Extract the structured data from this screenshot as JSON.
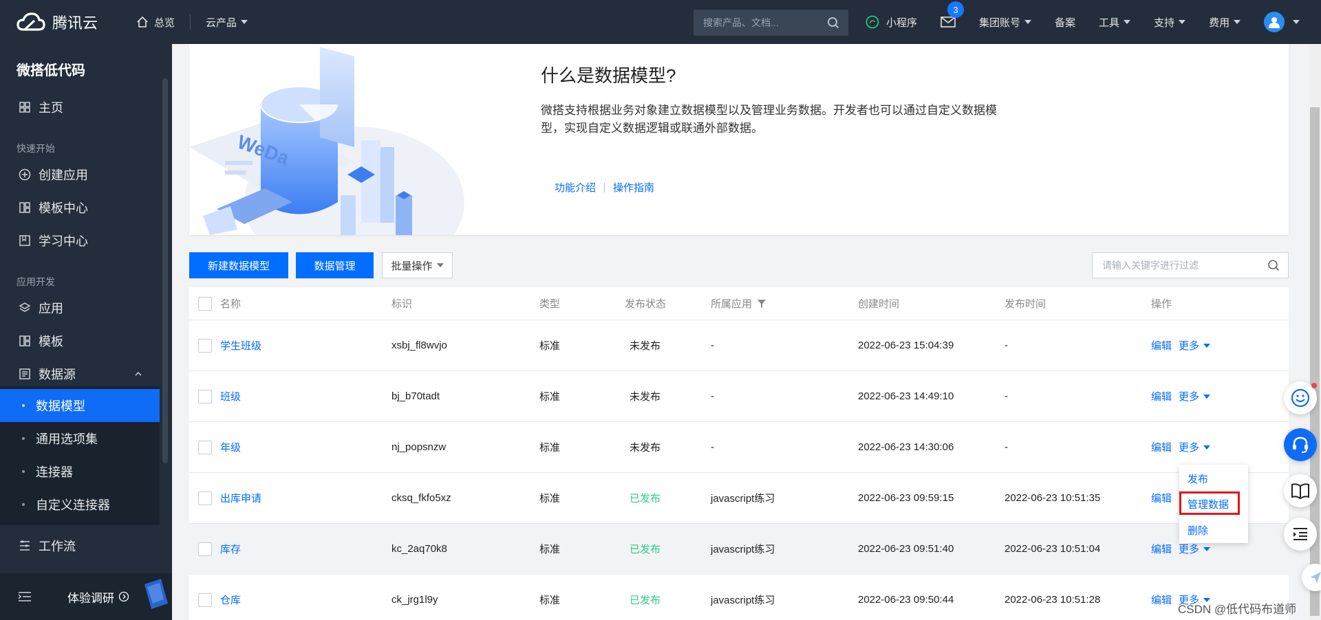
{
  "topbar": {
    "brand": "腾讯云",
    "home": "总览",
    "products": "云产品",
    "search_placeholder": "搜索产品、文档...",
    "mini_program": "小程序",
    "mail_badge": "3",
    "group_account": "集团账号",
    "filing": "备案",
    "tools": "工具",
    "support": "支持",
    "fees": "费用"
  },
  "sidebar": {
    "title": "微搭低代码",
    "home": "主页",
    "group_quick": "快速开始",
    "create_app": "创建应用",
    "template_center": "模板中心",
    "learning_center": "学习中心",
    "group_dev": "应用开发",
    "apps": "应用",
    "templates": "模板",
    "datasource": "数据源",
    "sub": [
      "数据模型",
      "通用选项集",
      "连接器",
      "自定义连接器"
    ],
    "workflow": "工作流",
    "survey": "体验调研"
  },
  "intro": {
    "title": "什么是数据模型?",
    "desc": "微搭支持根据业务对象建立数据模型以及管理业务数据。开发者也可以通过自定义数据模型，实现自定义数据逻辑或联通外部数据。",
    "link1": "功能介绍",
    "link2": "操作指南",
    "illustration_text": "WeDa"
  },
  "toolbar": {
    "new_model": "新建数据模型",
    "data_manage": "数据管理",
    "batch": "批量操作",
    "filter_placeholder": "请输入关键字进行过滤"
  },
  "table": {
    "headers": [
      "名称",
      "标识",
      "类型",
      "发布状态",
      "所属应用",
      "创建时间",
      "发布时间",
      "操作"
    ],
    "edit": "编辑",
    "more": "更多",
    "rows": [
      {
        "name": "学生班级",
        "id": "xsbj_fl8wvjo",
        "type": "标准",
        "status": "未发布",
        "app": "-",
        "created": "2022-06-23 15:04:39",
        "published": "-"
      },
      {
        "name": "班级",
        "id": "bj_b70tadt",
        "type": "标准",
        "status": "未发布",
        "app": "-",
        "created": "2022-06-23 14:49:10",
        "published": "-"
      },
      {
        "name": "年级",
        "id": "nj_popsnzw",
        "type": "标准",
        "status": "未发布",
        "app": "-",
        "created": "2022-06-23 14:30:06",
        "published": "-"
      },
      {
        "name": "出库申请",
        "id": "cksq_fkfo5xz",
        "type": "标准",
        "status": "已发布",
        "app": "javascript练习",
        "created": "2022-06-23 09:59:15",
        "published": "2022-06-23 10:51:35"
      },
      {
        "name": "库存",
        "id": "kc_2aq70k8",
        "type": "标准",
        "status": "已发布",
        "app": "javascript练习",
        "created": "2022-06-23 09:51:40",
        "published": "2022-06-23 10:51:04"
      },
      {
        "name": "仓库",
        "id": "ck_jrg1l9y",
        "type": "标准",
        "status": "已发布",
        "app": "javascript练习",
        "created": "2022-06-23 09:50:44",
        "published": "2022-06-23 10:51:28"
      }
    ]
  },
  "dropdown": [
    "发布",
    "管理数据",
    "删除"
  ],
  "watermark": "CSDN @低代码布道师",
  "colors": {
    "primary": "#006eff",
    "published": "#29cc85",
    "highlight": "#e2151b",
    "sidebar": "#232d3b"
  }
}
